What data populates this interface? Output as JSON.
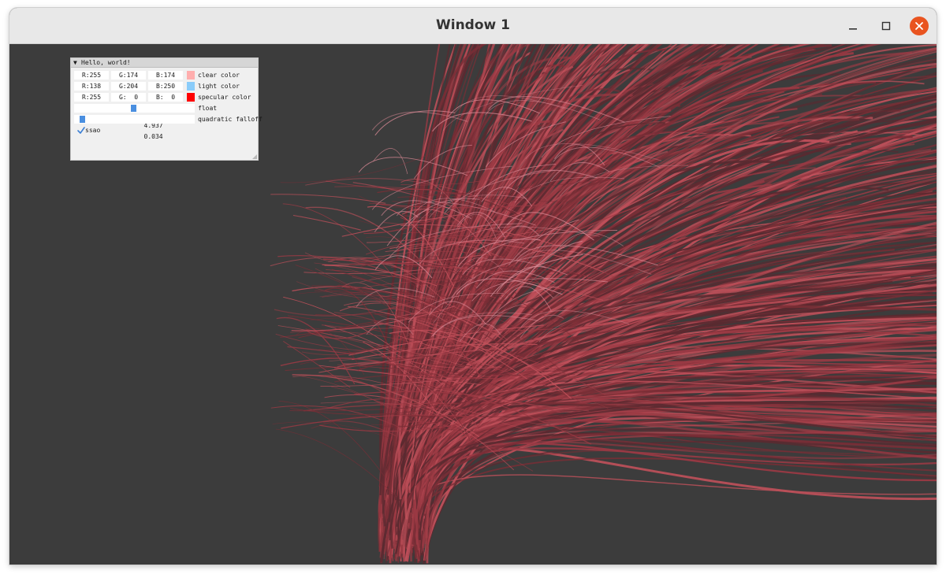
{
  "window": {
    "title": "Window 1",
    "buttons": {
      "minimize_icon": "minimize-icon",
      "maximize_icon": "maximize-icon",
      "close_icon": "close-icon"
    },
    "accent": "#e95420"
  },
  "viewport": {
    "background_color": "#3c3c3c",
    "hair_colors": [
      "#5a2a30",
      "#7a2e36",
      "#9c3a44",
      "#c0505a",
      "#d98a96"
    ]
  },
  "imgui": {
    "header_title": "Hello, world!",
    "rows": [
      {
        "r": "R:255",
        "g": "G:174",
        "b": "B:174",
        "swatch": "#ffaeae",
        "label": "clear color"
      },
      {
        "r": "R:138",
        "g": "G:204",
        "b": "B:250",
        "swatch": "#8accfa",
        "label": "light color"
      },
      {
        "r": "R:255",
        "g": "G:  0",
        "b": "B:  0",
        "swatch": "#ff0000",
        "label": "specular color"
      }
    ],
    "float_slider": {
      "value": "4.937",
      "label": "float",
      "fill_fraction": 0.49
    },
    "falloff_slider": {
      "value": "0.034",
      "label": "quadratic falloff",
      "fill_fraction": 0.03
    },
    "checkbox": {
      "label": "ssao",
      "checked": true
    }
  }
}
